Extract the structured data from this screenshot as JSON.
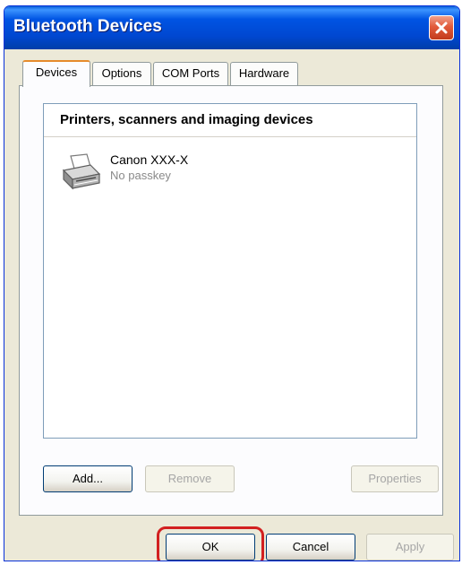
{
  "window": {
    "title": "Bluetooth Devices"
  },
  "tabs": [
    {
      "label": "Devices",
      "active": true
    },
    {
      "label": "Options",
      "active": false
    },
    {
      "label": "COM Ports",
      "active": false
    },
    {
      "label": "Hardware",
      "active": false
    }
  ],
  "devices": {
    "group_header": "Printers, scanners and imaging devices",
    "items": [
      {
        "name": "Canon XXX-X",
        "status": "No passkey",
        "icon": "printer-icon"
      }
    ]
  },
  "panel_buttons": {
    "add": "Add...",
    "remove": "Remove",
    "properties": "Properties"
  },
  "dialog_buttons": {
    "ok": "OK",
    "cancel": "Cancel",
    "apply": "Apply"
  },
  "highlight": {
    "target": "ok-button",
    "color": "#d22020"
  },
  "colors": {
    "titlebar": "#0054e3",
    "close": "#e25b3b",
    "active_tab": "#e68b2c"
  }
}
